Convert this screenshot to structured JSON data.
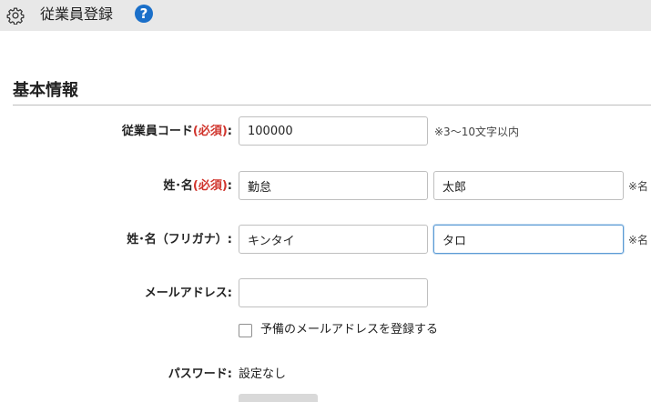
{
  "header": {
    "title": "従業員登録",
    "help_symbol": "?"
  },
  "section": {
    "title": "基本情報"
  },
  "fields": {
    "employee_code": {
      "label": "従業員コード",
      "required": "(必須)",
      "colon": ":",
      "value": "100000",
      "hint": "※3～10文字以内"
    },
    "name": {
      "label": "姓･名",
      "required": "(必須)",
      "colon": ":",
      "last_value": "勤怠",
      "first_value": "太郎",
      "hint": "※名"
    },
    "name_kana": {
      "label": "姓･名（フリガナ）",
      "colon": ":",
      "last_value": "キンタイ",
      "first_value": "タロ",
      "hint": "※名"
    },
    "email": {
      "label": "メールアドレス",
      "colon": ":",
      "value": ""
    },
    "backup_email": {
      "checkbox_label": "予備のメールアドレスを登録する"
    },
    "password": {
      "label": "パスワード",
      "colon": ":",
      "value": "設定なし"
    }
  },
  "colors": {
    "required": "#d0342c",
    "help_icon": "#1a6fc9",
    "topbar": "#e8e8e8"
  }
}
